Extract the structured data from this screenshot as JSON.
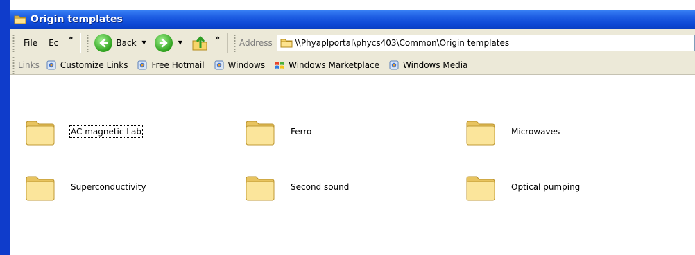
{
  "window": {
    "title": "Origin templates"
  },
  "toolbar": {
    "menu": [
      "File",
      "Ec"
    ],
    "chevron": "»",
    "back_label": "Back",
    "dropdown": "▼",
    "address_label": "Address",
    "address_value": "\\\\Phyaplportal\\phycs403\\Common\\Origin templates"
  },
  "links": {
    "label": "Links",
    "items": [
      {
        "label": "Customize Links"
      },
      {
        "label": "Free Hotmail"
      },
      {
        "label": "Windows"
      },
      {
        "label": "Windows Marketplace"
      },
      {
        "label": "Windows Media"
      }
    ]
  },
  "folders": [
    {
      "name": "AC magnetic Lab"
    },
    {
      "name": "Ferro"
    },
    {
      "name": "Microwaves"
    },
    {
      "name": "Superconductivity"
    },
    {
      "name": "Second sound"
    },
    {
      "name": "Optical pumping"
    }
  ],
  "colors": {
    "titlebar": "#0d48d5",
    "toolbar": "#ece9d8",
    "folder": "#f4d67a"
  }
}
